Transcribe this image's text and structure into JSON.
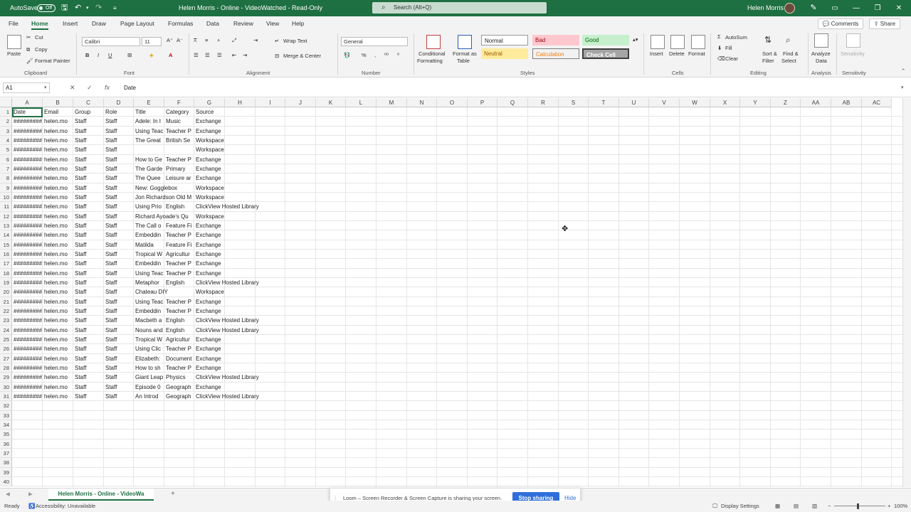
{
  "titlebar": {
    "autosave": "AutoSave",
    "toggle": "Off",
    "title": "Helen Morris - Online - VideoWatched - Read-Only",
    "search": "Search (Alt+Q)",
    "user": "Helen Morris"
  },
  "menu": {
    "tabs": [
      "File",
      "Home",
      "Insert",
      "Draw",
      "Page Layout",
      "Formulas",
      "Data",
      "Review",
      "View",
      "Help"
    ],
    "active": "Home",
    "comments": "Comments",
    "share": "Share"
  },
  "ribbon": {
    "clipboard": {
      "paste": "Paste",
      "cut": "Cut",
      "copy": "Copy",
      "format_painter": "Format Painter",
      "label": "Clipboard"
    },
    "font": {
      "name": "Calibri",
      "size": "11",
      "label": "Font"
    },
    "alignment": {
      "wrap": "Wrap Text",
      "merge": "Merge & Center",
      "label": "Alignment"
    },
    "number": {
      "format": "General",
      "label": "Number"
    },
    "styles": {
      "conditional": [
        "Conditional",
        "Formatting"
      ],
      "format_table": [
        "Format as",
        "Table"
      ],
      "normal": "Normal",
      "bad": "Bad",
      "good": "Good",
      "neutral": "Neutral",
      "calculation": "Calculation",
      "check": "Check Cell",
      "label": "Styles"
    },
    "cells": {
      "insert": "Insert",
      "delete": "Delete",
      "format": "Format",
      "label": "Cells"
    },
    "editing": {
      "autosum": "AutoSum",
      "fill": "Fill",
      "clear": "Clear",
      "sort": [
        "Sort &",
        "Filter"
      ],
      "find": [
        "Find &",
        "Select"
      ],
      "label": "Editing"
    },
    "analysis": {
      "analyze": [
        "Analyze",
        "Data"
      ],
      "label": "Analysis"
    },
    "sensitivity": {
      "btn": "Sensitivity",
      "label": "Sensitivity"
    }
  },
  "formula_bar": {
    "cell_ref": "A1",
    "fx": "fx",
    "value": "Date"
  },
  "grid": {
    "columns": [
      "A",
      "B",
      "C",
      "D",
      "E",
      "F",
      "G",
      "H",
      "I",
      "J",
      "K",
      "L",
      "M",
      "N",
      "O",
      "P",
      "Q",
      "R",
      "S",
      "T",
      "U",
      "V",
      "W",
      "X",
      "Y",
      "Z",
      "AA",
      "AB",
      "AC"
    ],
    "row_numbers": [
      "1",
      "2",
      "3",
      "4",
      "5",
      "6",
      "7",
      "8",
      "9",
      "10",
      "11",
      "12",
      "13",
      "14",
      "15",
      "16",
      "17",
      "18",
      "19",
      "20",
      "21",
      "22",
      "23",
      "24",
      "25",
      "26",
      "27",
      "28",
      "29",
      "30",
      "31",
      "32",
      "33",
      "34",
      "35",
      "36",
      "37",
      "38",
      "39",
      "40"
    ],
    "rows": [
      [
        "Date",
        "Email",
        "Group",
        "Role",
        "Title",
        "Category",
        "Source"
      ],
      [
        "#########",
        "helen.mo",
        "Staff",
        "Staff",
        "Adele: In I",
        "Music",
        "Exchange"
      ],
      [
        "#########",
        "helen.mo",
        "Staff",
        "Staff",
        "Using Teac",
        "Teacher P",
        "Exchange"
      ],
      [
        "#########",
        "helen.mo",
        "Staff",
        "Staff",
        "The Great",
        "British Se",
        "Workspace"
      ],
      [
        "#########",
        "helen.mo",
        "Staff",
        "Staff",
        "",
        "",
        "Workspace"
      ],
      [
        "#########",
        "helen.mo",
        "Staff",
        "Staff",
        "How to Ge",
        "Teacher P",
        "Exchange"
      ],
      [
        "#########",
        "helen.mo",
        "Staff",
        "Staff",
        "The Garde",
        "Primary",
        "Exchange"
      ],
      [
        "#########",
        "helen.mo",
        "Staff",
        "Staff",
        "The Quee",
        "Leisure ar",
        "Exchange"
      ],
      [
        "#########",
        "helen.mo",
        "Staff",
        "Staff",
        "New: Gogglebox",
        "",
        "Workspace"
      ],
      [
        "#########",
        "helen.mo",
        "Staff",
        "Staff",
        "Jon Richardson Old M",
        "",
        "Workspace"
      ],
      [
        "#########",
        "helen.mo",
        "Staff",
        "Staff",
        "Using Prio",
        "English",
        "ClickView Hosted Library"
      ],
      [
        "#########",
        "helen.mo",
        "Staff",
        "Staff",
        "Richard Ayoade's Qu",
        "",
        "Workspace"
      ],
      [
        "#########",
        "helen.mo",
        "Staff",
        "Staff",
        "The Call o",
        "Feature Fi",
        "Exchange"
      ],
      [
        "#########",
        "helen.mo",
        "Staff",
        "Staff",
        "Embeddin",
        "Teacher P",
        "Exchange"
      ],
      [
        "#########",
        "helen.mo",
        "Staff",
        "Staff",
        "Matilda",
        "Feature Fi",
        "Exchange"
      ],
      [
        "#########",
        "helen.mo",
        "Staff",
        "Staff",
        "Tropical W",
        "Agricultur",
        "Exchange"
      ],
      [
        "#########",
        "helen.mo",
        "Staff",
        "Staff",
        "Embeddin",
        "Teacher P",
        "Exchange"
      ],
      [
        "#########",
        "helen.mo",
        "Staff",
        "Staff",
        "Using Teac",
        "Teacher P",
        "Exchange"
      ],
      [
        "#########",
        "helen.mo",
        "Staff",
        "Staff",
        "Metaphor",
        "English",
        "ClickView Hosted Library"
      ],
      [
        "#########",
        "helen.mo",
        "Staff",
        "Staff",
        "Chateau DIY",
        "",
        "Workspace"
      ],
      [
        "#########",
        "helen.mo",
        "Staff",
        "Staff",
        "Using Teac",
        "Teacher P",
        "Exchange"
      ],
      [
        "#########",
        "helen.mo",
        "Staff",
        "Staff",
        "Embeddin",
        "Teacher P",
        "Exchange"
      ],
      [
        "#########",
        "helen.mo",
        "Staff",
        "Staff",
        "Macbeth a",
        "English",
        "ClickView Hosted Library"
      ],
      [
        "#########",
        "helen.mo",
        "Staff",
        "Staff",
        "Nouns and",
        "English",
        "ClickView Hosted Library"
      ],
      [
        "#########",
        "helen.mo",
        "Staff",
        "Staff",
        "Tropical W",
        "Agricultur",
        "Exchange"
      ],
      [
        "#########",
        "helen.mo",
        "Staff",
        "Staff",
        "Using Clic",
        "Teacher P",
        "Exchange"
      ],
      [
        "#########",
        "helen.mo",
        "Staff",
        "Staff",
        "Elizabeth:",
        "Document",
        "Exchange"
      ],
      [
        "#########",
        "helen.mo",
        "Staff",
        "Staff",
        "How to sh",
        "Teacher P",
        "Exchange"
      ],
      [
        "#########",
        "helen.mo",
        "Staff",
        "Staff",
        "Giant Leap",
        "Physics",
        "ClickView Hosted Library"
      ],
      [
        "#########",
        "helen.mo",
        "Staff",
        "Staff",
        "Episode 0",
        "Geograph",
        "Exchange"
      ],
      [
        "#########",
        "helen.mo",
        "Staff",
        "Staff",
        "An Introd",
        "Geograph",
        "ClickView Hosted Library"
      ]
    ]
  },
  "sheet_tabs": {
    "active": "Helen Morris - Online - VideoWa",
    "add": "+"
  },
  "loom": {
    "message": "Loom – Screen Recorder & Screen Capture is sharing your screen.",
    "stop": "Stop sharing",
    "hide": "Hide"
  },
  "status": {
    "ready": "Ready",
    "accessibility": "Accessibility: Unavailable",
    "display": "Display Settings",
    "zoom": "100%"
  },
  "colors": {
    "accent": "#1e6f42",
    "loom_button": "#2f6fdb"
  }
}
